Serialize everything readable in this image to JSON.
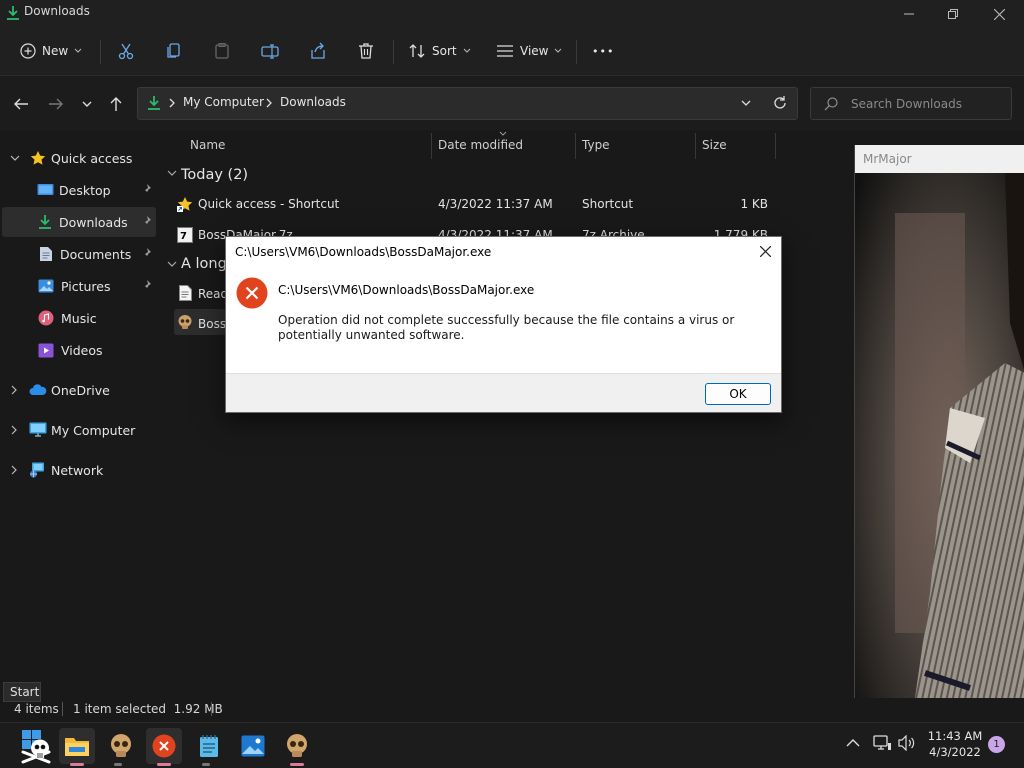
{
  "window": {
    "title": "Downloads"
  },
  "toolbar": {
    "new_label": "New",
    "sort_label": "Sort",
    "view_label": "View",
    "more_label": "•••"
  },
  "address": {
    "crumbs": [
      "My Computer",
      "Downloads"
    ],
    "search_placeholder": "Search Downloads"
  },
  "sidebar": {
    "items": [
      {
        "label": "Quick access"
      },
      {
        "label": "Desktop"
      },
      {
        "label": "Downloads"
      },
      {
        "label": "Documents"
      },
      {
        "label": "Pictures"
      },
      {
        "label": "Music"
      },
      {
        "label": "Videos"
      },
      {
        "label": "OneDrive"
      },
      {
        "label": "My Computer"
      },
      {
        "label": "Network"
      }
    ]
  },
  "files": {
    "columns": [
      "Name",
      "Date modified",
      "Type",
      "Size"
    ],
    "groups": [
      {
        "title": "Today (2)",
        "rows": [
          {
            "name": "Quick access - Shortcut",
            "date": "4/3/2022 11:37 AM",
            "type": "Shortcut",
            "size": "1 KB"
          },
          {
            "name": "BossDaMajor.7z",
            "date": "4/3/2022 11:37 AM",
            "type": "7z Archive",
            "size": "1,779 KB"
          }
        ]
      },
      {
        "title": "A long",
        "rows": [
          {
            "name": "Read"
          },
          {
            "name": "BossD"
          }
        ]
      }
    ]
  },
  "preview": {
    "title": "MrMajor"
  },
  "status": {
    "count": "4 items",
    "selected": "1 item selected  1.92 MB"
  },
  "tooltip": {
    "start": "Start"
  },
  "dialog": {
    "title": "C:\\Users\\VM6\\Downloads\\BossDaMajor.exe",
    "path": "C:\\Users\\VM6\\Downloads\\BossDaMajor.exe",
    "message": "Operation did not complete successfully because the file contains a virus or potentially unwanted software.",
    "ok_label": "OK"
  },
  "tray": {
    "time": "11:43 AM",
    "date": "4/3/2022",
    "notifications": "1"
  },
  "colors": {
    "accent": "#0067c0",
    "error": "#e0431e",
    "download_green": "#2dba6b"
  }
}
